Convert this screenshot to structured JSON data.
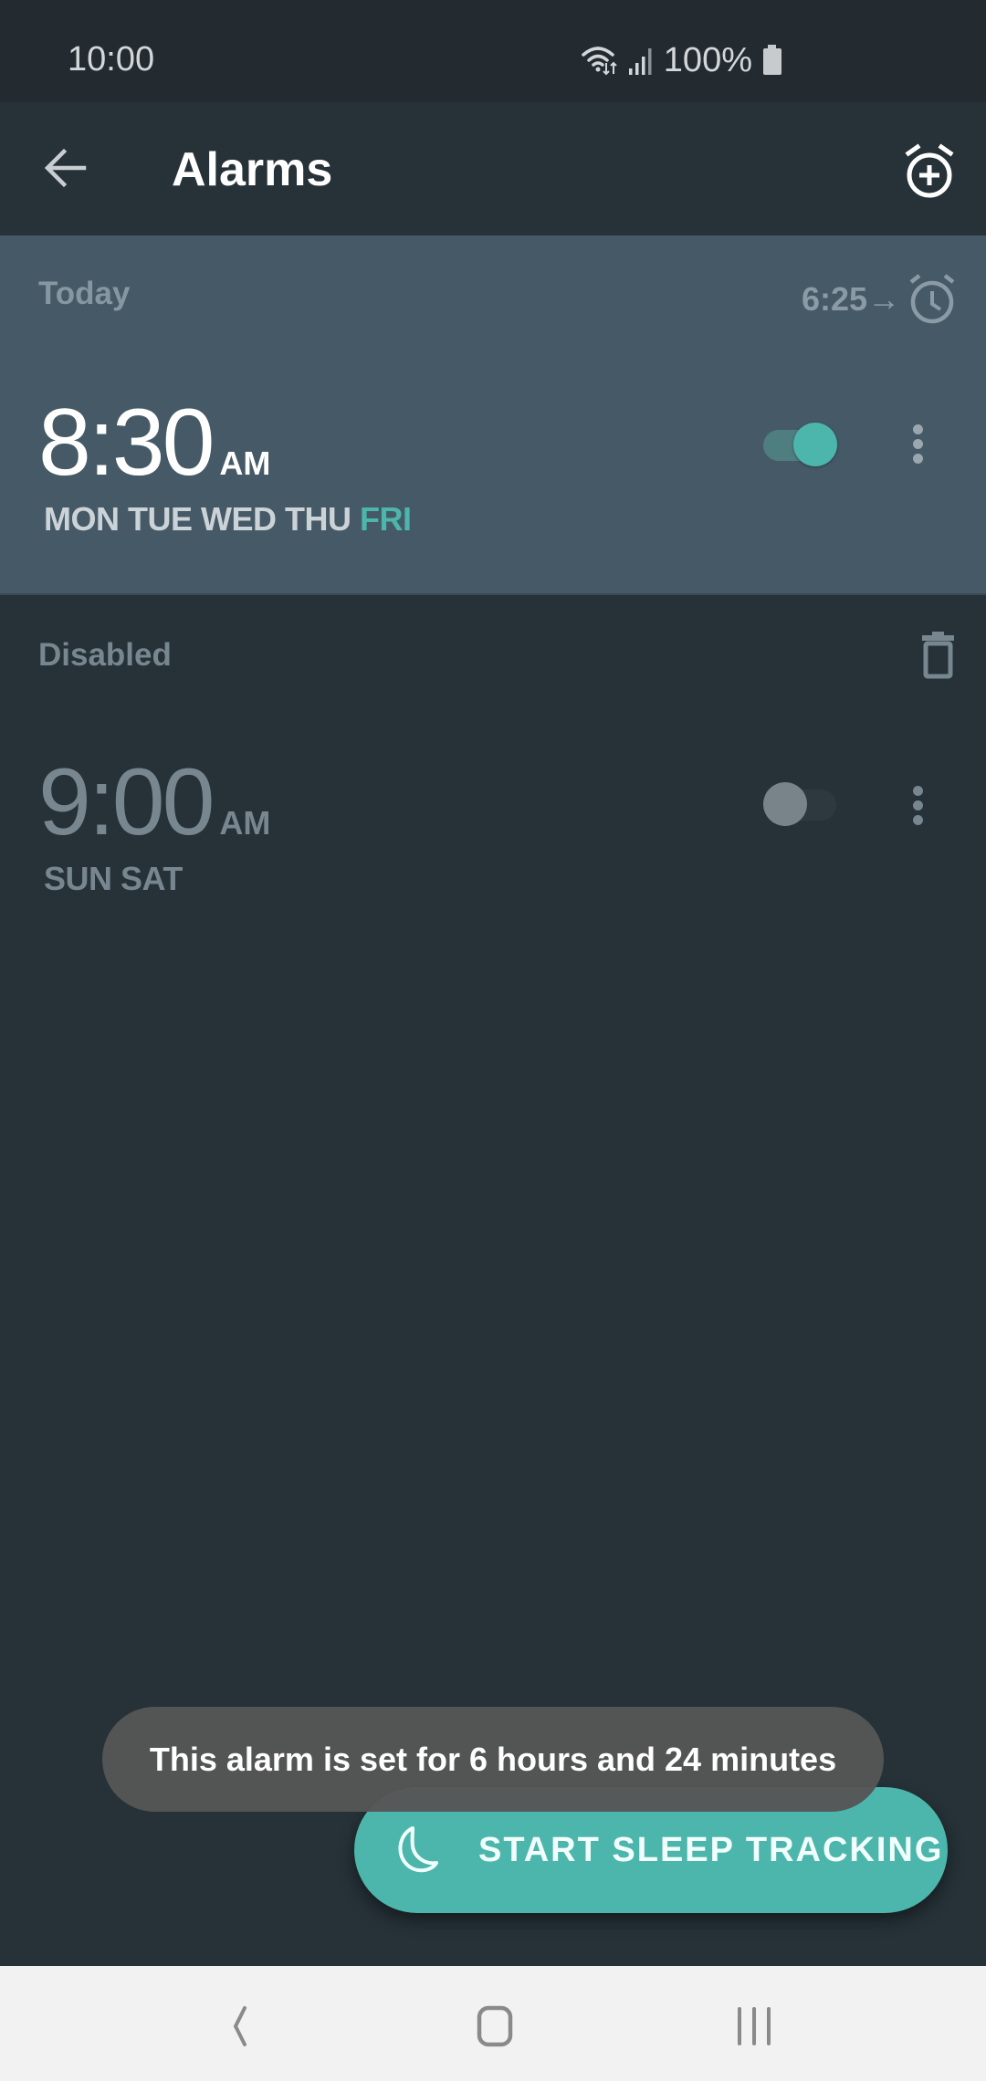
{
  "status_bar": {
    "time": "10:00",
    "battery": "100%",
    "icons": [
      "wifi-icon",
      "signal-icon",
      "battery-icon"
    ]
  },
  "toolbar": {
    "title": "Alarms",
    "back_icon": "arrow-left-icon",
    "add_icon": "alarm-add-icon"
  },
  "sections": {
    "active": {
      "label": "Today",
      "next_alarm_in": "6:25→",
      "next_icon": "alarm-clock-icon"
    },
    "disabled": {
      "label": "Disabled",
      "delete_icon": "trash-icon"
    }
  },
  "alarms": [
    {
      "time": "8:30",
      "ampm": "AM",
      "days_normal": "MON TUE WED THU ",
      "days_highlight": "FRI",
      "enabled": true
    },
    {
      "time": "9:00",
      "ampm": "AM",
      "days_normal": "SUN SAT",
      "days_highlight": "",
      "enabled": false
    }
  ],
  "toast": {
    "message": "This alarm is set for 6 hours and 24 minutes"
  },
  "fab": {
    "label": "START SLEEP TRACKING",
    "icon": "moon-icon"
  },
  "colors": {
    "accent": "#4db6ac",
    "active_card": "#455a66",
    "background": "#263238",
    "toast": "#555555"
  },
  "nav_bar": {
    "buttons": [
      "back",
      "home",
      "recents"
    ]
  }
}
